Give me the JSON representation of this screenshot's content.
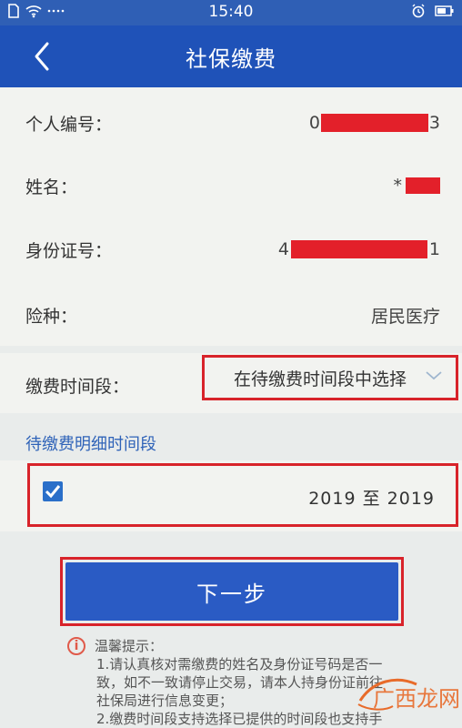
{
  "status_bar": {
    "time": "15:40"
  },
  "header": {
    "title": "社保缴费"
  },
  "info": {
    "personal_number": {
      "label": "个人编号：",
      "value_start": "0",
      "value_end": "3"
    },
    "name": {
      "label": "姓名：",
      "value_start": "*"
    },
    "id_number": {
      "label": "身份证号：",
      "value_start": "4",
      "value_end": "1"
    },
    "insurance_type": {
      "label": "险种：",
      "value": "居民医疗"
    }
  },
  "payment_period": {
    "label": "缴费时间段：",
    "select_value": "在待缴费时间段中选择"
  },
  "detail": {
    "section_title": "待缴费明细时间段",
    "items": [
      {
        "range": "2019 至 2019",
        "checked": true
      }
    ]
  },
  "next_button": {
    "label": "下一步"
  },
  "tips": {
    "title": "温馨提示：",
    "line1": "1.请认真核对需缴费的姓名及身份证号码是否一",
    "line2": "致，如不一致请停止交易，请本人持身份证前往",
    "line3": "社保局进行信息变更；",
    "line4": "2.缴费时间段支持选择已提供的时间段也支持手"
  },
  "watermark": {
    "text": "广西龙网"
  },
  "colors": {
    "header": "#1f52b8",
    "status_bar": "#2f5fb5",
    "button": "#2a5bc4",
    "highlight_border": "#d8232a",
    "section_title": "#2f63b8"
  }
}
